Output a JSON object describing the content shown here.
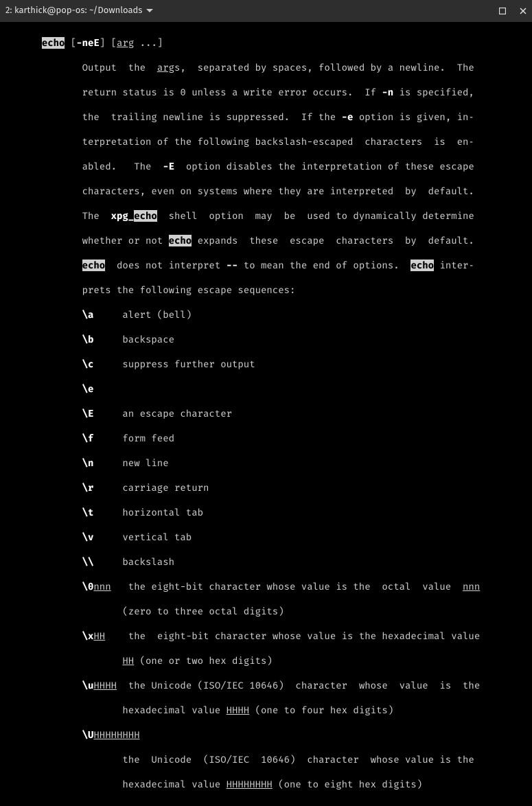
{
  "titlebar": {
    "label": "2: karthick@pop-os: ~/Downloads"
  },
  "man": {
    "cmd": "echo",
    "opt_neE": "-neE",
    "arg": "arg",
    "d1a": "              Output  the  ",
    "d1b": "s,  separated by spaces, followed by a newline.  The",
    "d2a": "              return status is 0 unless a write error occurs.  If ",
    "opt_n": "-n",
    "d2b": " is specified,",
    "d3a": "              the  trailing newline is suppressed.  If the ",
    "opt_e": "-e",
    "d3b": " option is given, in‐",
    "d4": "              terpretation of the following backslash-escaped  characters  is  en‐",
    "d5a": "              abled.   The  ",
    "opt_E": "-E",
    "d5b": "  option disables the interpretation of these escape",
    "d6": "              characters, even on systems where they are interpreted  by  default.",
    "d7a": "              The  ",
    "xpg": "xpg_",
    "d7b": "  shell  option  may  be  used to dynamically determine",
    "d8a": "              whether or not ",
    "d8b": " expands  these  escape  characters  by  default.",
    "d9a": "  does not interpret ",
    "ddash": "--",
    "d9b": " to mean the end of options.  ",
    "d9c": " inter‐",
    "d10": "              prets the following escape sequences:",
    "sa_k": "              \\a",
    "sa_v": "     alert (bell)",
    "sb_k": "              \\b",
    "sb_v": "     backspace",
    "sc_k": "              \\c",
    "sc_v": "     suppress further output",
    "se_k": "              \\e",
    "sE_k": "              \\E",
    "sE_v": "     an escape character",
    "sf_k": "              \\f",
    "sf_v": "     form feed",
    "sn_k": "              \\n",
    "sn_v": "     new line",
    "sr_k": "              \\r",
    "sr_v": "     carriage return",
    "st_k": "              \\t",
    "st_v": "     horizontal tab",
    "sv_k": "              \\v",
    "sv_v": "     vertical tab",
    "sbs_k": "              \\\\",
    "sbs_v": "     backslash",
    "s0_k": "              \\0",
    "nnn": "nnn",
    "s0_v1": "   the eight-bit character whose value is the  octal  value  ",
    "s0_v2": "                     (zero to three octal digits)",
    "sx_k": "              \\x",
    "HH": "HH",
    "sx_v1": "    the  eight-bit character whose value is the hexadecimal value",
    "sx_v2a": "                     ",
    "sx_v2b": " (one or two hex digits)",
    "su_k": "              \\u",
    "HHHH": "HHHH",
    "su_v1": "  the Unicode (ISO/IEC 10646)  character  whose  value  is  the",
    "su_v2a": "                     hexadecimal value ",
    "su_v2b": " (one to four hex digits)",
    "sU_k": "              \\U",
    "H8": "HHHHHHHH",
    "sU_v1": "                     the  Unicode  (ISO/IEC  10646)  character  whose value is the",
    "sU_v2a": "                     hexadecimal value ",
    "sU_v2b": " (one to eight hex digits)"
  }
}
